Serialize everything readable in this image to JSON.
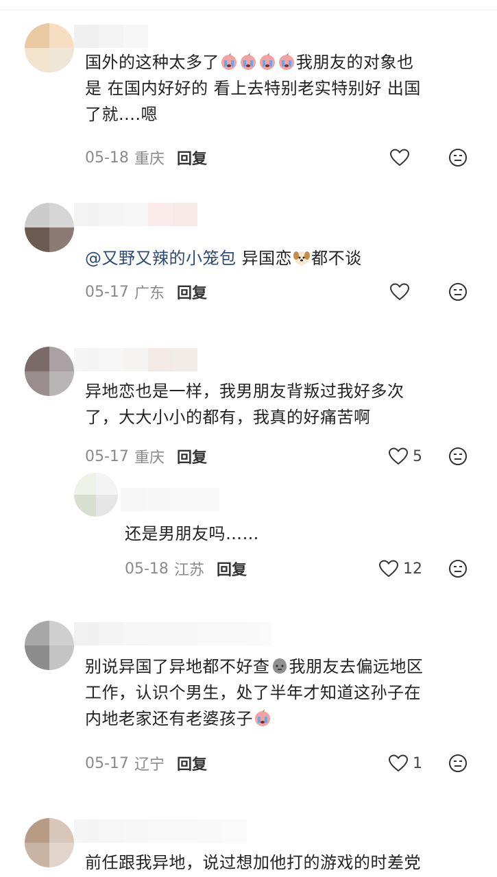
{
  "comments": [
    {
      "text_lines": [
        "国外的这种太多了",
        "是 在国内好好的 看上去特别老实特别好 出国",
        "了就....嗯"
      ],
      "text_tail_line1": "我朋友的对象也",
      "date": "05-18",
      "location": "重庆",
      "reply_label": "回复",
      "likes": ""
    },
    {
      "mention": "@又野又辣的小笼包",
      "text_a": "异国恋",
      "text_b": "都不谈",
      "date": "05-17",
      "location": "广东",
      "reply_label": "回复",
      "likes": ""
    },
    {
      "text_lines": [
        "异地恋也是一样，我男朋友背叛过我好多次",
        "了，大大小小的都有，我真的好痛苦啊"
      ],
      "date": "05-17",
      "location": "重庆",
      "reply_label": "回复",
      "likes": "5"
    },
    {
      "text_lines": [
        "还是男朋友吗……"
      ],
      "date": "05-18",
      "location": "江苏",
      "reply_label": "回复",
      "likes": "12"
    },
    {
      "text_a": "别说异国了异地都不好查",
      "text_b": "我朋友去偏远地区",
      "text_lines": [
        "工作，认识个男生，处了半年才知道这孙子在",
        "内地老家还有老婆孩子"
      ],
      "date": "05-17",
      "location": "辽宁",
      "reply_label": "回复",
      "likes": "1"
    },
    {
      "text_lines": [
        "前任跟我异地，说过想加他打的游戏的时差党"
      ]
    }
  ],
  "icons": {
    "like": "heart-outline-icon",
    "dislike": "dislike-face-icon",
    "crying_emoji": "crying-face-emoji",
    "dog_emoji": "dog-face-emoji",
    "speechless_emoji": "speechless-face-emoji"
  },
  "colors": {
    "text": "#222222",
    "meta": "#8a8a8a",
    "mention": "#2f4a78"
  }
}
